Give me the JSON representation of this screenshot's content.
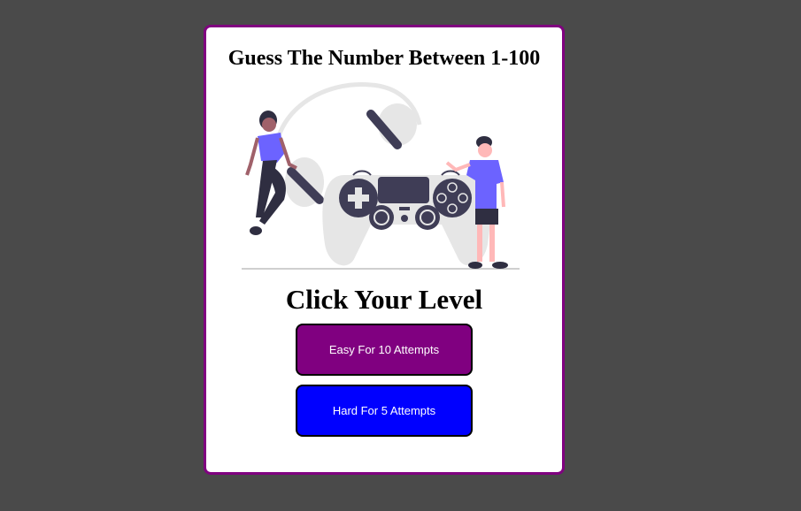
{
  "game": {
    "title": "Guess The Number Between 1-100",
    "level_heading": "Click Your Level",
    "easy_button": "Easy For 10 Attempts",
    "hard_button": "Hard For 5 Attempts"
  },
  "colors": {
    "background": "#4a4a4a",
    "card_border": "#800080",
    "easy_button": "#800080",
    "hard_button": "#0000ff",
    "illustration_accent": "#6c63ff",
    "illustration_dark": "#3f3d56",
    "illustration_light": "#e6e6e6"
  },
  "illustration": {
    "icon": "gamepad-illustration"
  }
}
